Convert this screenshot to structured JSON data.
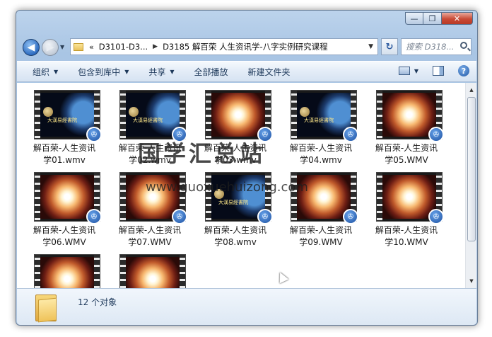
{
  "window": {
    "caption_buttons": [
      "—",
      "❐",
      "✕"
    ]
  },
  "navbar": {
    "back_icon": "back-arrow-icon",
    "forward_icon": "forward-arrow-icon",
    "address": {
      "overflow": "«",
      "crumbs": [
        "D3101-D3...",
        "D3185 解百荣 人生资讯学-八字实例研究课程"
      ]
    },
    "search_placeholder": "搜索 D318..."
  },
  "toolbar": {
    "items": [
      "组织",
      "包含到库中",
      "共享",
      "全部播放",
      "新建文件夹"
    ],
    "help": "?"
  },
  "files": [
    {
      "name": "解百荣-人生资讯学01.wmv",
      "line1": "解百荣-人生资讯",
      "line2": "学01.wmv",
      "thumb": "space"
    },
    {
      "name": "解百荣-人生资讯学02.wmv",
      "line1": "解百荣-人生资讯",
      "line2": "学02.wmv",
      "thumb": "space"
    },
    {
      "name": "解百荣-人生资讯学03.wmv",
      "line1": "解百荣-人生资讯",
      "line2": "学03.wmv",
      "thumb": "flare"
    },
    {
      "name": "解百荣-人生资讯学04.wmv",
      "line1": "解百荣-人生资讯",
      "line2": "学04.wmv",
      "thumb": "space"
    },
    {
      "name": "解百荣-人生资讯学05.WMV",
      "line1": "解百荣-人生资讯",
      "line2": "学05.WMV",
      "thumb": "flare"
    },
    {
      "name": "解百荣-人生资讯学06.WMV",
      "line1": "解百荣-人生资讯",
      "line2": "学06.WMV",
      "thumb": "flare"
    },
    {
      "name": "解百荣-人生资讯学07.WMV",
      "line1": "解百荣-人生资讯",
      "line2": "学07.WMV",
      "thumb": "flare"
    },
    {
      "name": "解百荣-人生资讯学08.wmv",
      "line1": "解百荣-人生资讯",
      "line2": "学08.wmv",
      "thumb": "space"
    },
    {
      "name": "解百荣-人生资讯学09.WMV",
      "line1": "解百荣-人生资讯",
      "line2": "学09.WMV",
      "thumb": "flare"
    },
    {
      "name": "解百荣-人生资讯学10.WMV",
      "line1": "解百荣-人生资讯",
      "line2": "学10.WMV",
      "thumb": "flare"
    },
    {
      "name": "",
      "line1": "",
      "line2": "",
      "thumb": "flare"
    },
    {
      "name": "",
      "line1": "",
      "line2": "",
      "thumb": "flare"
    }
  ],
  "thumb_caption": "大漢易經書院",
  "watermark": {
    "text": "国学汇总站",
    "url": "www.guoxuehuizong.com"
  },
  "details": {
    "count": "12 个对象"
  }
}
